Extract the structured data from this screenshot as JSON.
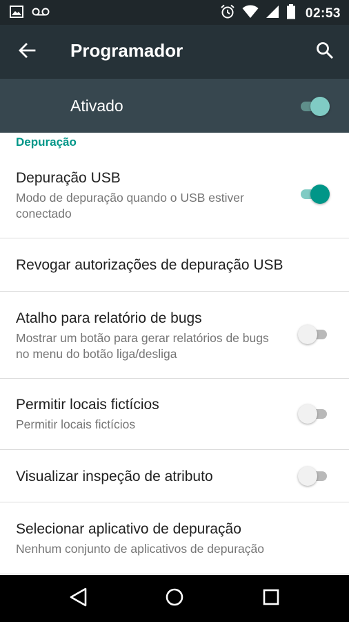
{
  "status_bar": {
    "time": "02:53",
    "icons": [
      "image-icon",
      "voicemail-icon",
      "alarm-icon",
      "wifi-icon",
      "signal-icon",
      "battery-icon"
    ]
  },
  "app_bar": {
    "title": "Programador",
    "back_icon": "arrow-back-icon",
    "search_icon": "search-icon"
  },
  "master_switch": {
    "label": "Ativado",
    "checked": true
  },
  "section": {
    "title": "Depuração"
  },
  "settings": [
    {
      "title": "Depuração USB",
      "summary": "Modo de depuração quando o USB estiver conectado",
      "switch": true,
      "checked": true
    },
    {
      "title": "Revogar autorizações de depuração USB",
      "summary": "",
      "switch": false
    },
    {
      "title": "Atalho para relatório de bugs",
      "summary": "Mostrar um botão para gerar relatórios de bugs no menu do botão liga/desliga",
      "switch": true,
      "checked": false
    },
    {
      "title": "Permitir locais fictícios",
      "summary": "Permitir locais fictícios",
      "switch": true,
      "checked": false
    },
    {
      "title": "Visualizar inspeção de atributo",
      "summary": "",
      "switch": true,
      "checked": false
    },
    {
      "title": "Selecionar aplicativo de depuração",
      "summary": "Nenhum conjunto de aplicativos de depuração",
      "switch": false
    }
  ],
  "nav_bar": {
    "icons": [
      "back-triangle-icon",
      "home-circle-icon",
      "recents-square-icon"
    ]
  },
  "colors": {
    "accent": "#009688",
    "app_bar": "#263238",
    "master_bar": "#37474f",
    "status_bar": "#1f272b"
  }
}
